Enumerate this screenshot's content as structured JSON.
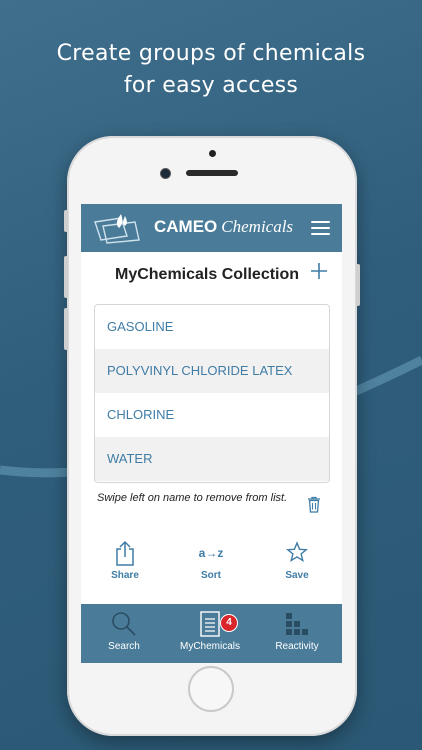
{
  "promo": {
    "line1": "Create groups of chemicals",
    "line2": "for easy access"
  },
  "header": {
    "brand_bold": "CAMEO",
    "brand_italic": "Chemicals",
    "menu_icon": "hamburger-menu-icon"
  },
  "collection": {
    "title": "MyChemicals Collection",
    "add_icon": "plus-icon",
    "items": [
      "GASOLINE",
      "POLYVINYL CHLORIDE LATEX",
      "CHLORINE",
      "WATER"
    ],
    "hint": "Swipe left on name to remove from list.",
    "trash_icon": "trash-icon"
  },
  "actions": {
    "share_label": "Share",
    "sort_glyph": "a→z",
    "sort_label": "Sort",
    "save_label": "Save"
  },
  "tabbar": {
    "search_label": "Search",
    "mychemicals_label": "MyChemicals",
    "mychemicals_badge": "4",
    "reactivity_label": "Reactivity"
  },
  "colors": {
    "header_bg": "#4a7c99",
    "link_blue": "#3f7ca6",
    "badge_red": "#d9262a",
    "background": "#2f5e7c"
  }
}
